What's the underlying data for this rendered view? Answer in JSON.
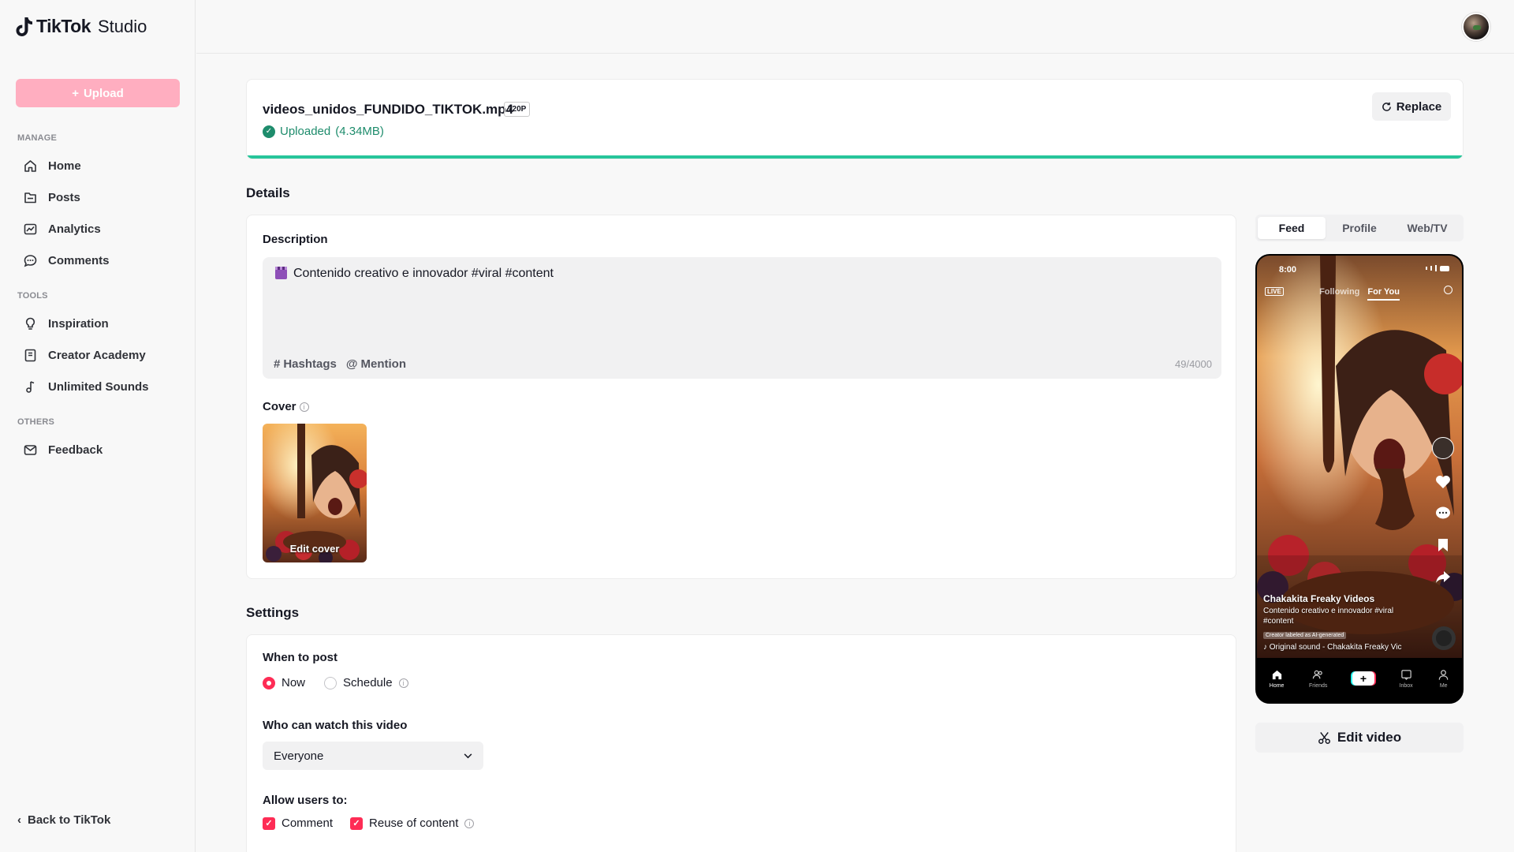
{
  "app": {
    "brand": "TikTok",
    "product": "Studio"
  },
  "sidebar": {
    "upload_label": "Upload",
    "sections": {
      "manage": "MANAGE",
      "tools": "TOOLS",
      "others": "OTHERS"
    },
    "items": [
      {
        "label": "Home",
        "icon": "home-icon"
      },
      {
        "label": "Posts",
        "icon": "posts-icon"
      },
      {
        "label": "Analytics",
        "icon": "analytics-icon"
      },
      {
        "label": "Comments",
        "icon": "comments-icon"
      },
      {
        "label": "Inspiration",
        "icon": "lightbulb-icon"
      },
      {
        "label": "Creator Academy",
        "icon": "academy-icon"
      },
      {
        "label": "Unlimited Sounds",
        "icon": "music-note-icon"
      },
      {
        "label": "Feedback",
        "icon": "mail-icon"
      }
    ],
    "back_label": "Back to TikTok"
  },
  "file": {
    "name": "videos_unidos_FUNDIDO_TIKTOK.mp4",
    "resolution": "720P",
    "status": "Uploaded",
    "size": "(4.34MB)",
    "replace_label": "Replace",
    "progress": 1.0
  },
  "details": {
    "title": "Details",
    "description_label": "Description",
    "description_text": "Contenido creativo e innovador #viral #content",
    "hashtags_label": "Hashtags",
    "mention_label": "Mention",
    "char_count": "49/4000",
    "cover_label": "Cover",
    "edit_cover_label": "Edit cover"
  },
  "settings": {
    "title": "Settings",
    "when_label": "When to post",
    "now_label": "Now",
    "schedule_label": "Schedule",
    "selected_when": "Now",
    "who_label": "Who can watch this video",
    "who_value": "Everyone",
    "allow_label": "Allow users to:",
    "comment_label": "Comment",
    "reuse_label": "Reuse of content",
    "comment_checked": true,
    "reuse_checked": true
  },
  "preview": {
    "tabs": [
      "Feed",
      "Profile",
      "Web/TV"
    ],
    "active_tab": "Feed",
    "phone": {
      "time": "8:00",
      "live": "LIVE",
      "following": "Following",
      "for_you": "For You",
      "username": "Chakakita Freaky Videos",
      "caption": "Contenido creativo e innovador #viral #content",
      "ai_label": "Creator labeled as AI-generated",
      "sound": "Original sound - Chakakita Freaky Vic",
      "nav": [
        "Home",
        "Friends",
        "",
        "Inbox",
        "Me"
      ]
    },
    "edit_video_label": "Edit video"
  },
  "colors": {
    "accent": "#fe2c55",
    "upload_disabled": "#ffaec0",
    "success": "#1e8c6c",
    "progress": "#27c59a"
  }
}
